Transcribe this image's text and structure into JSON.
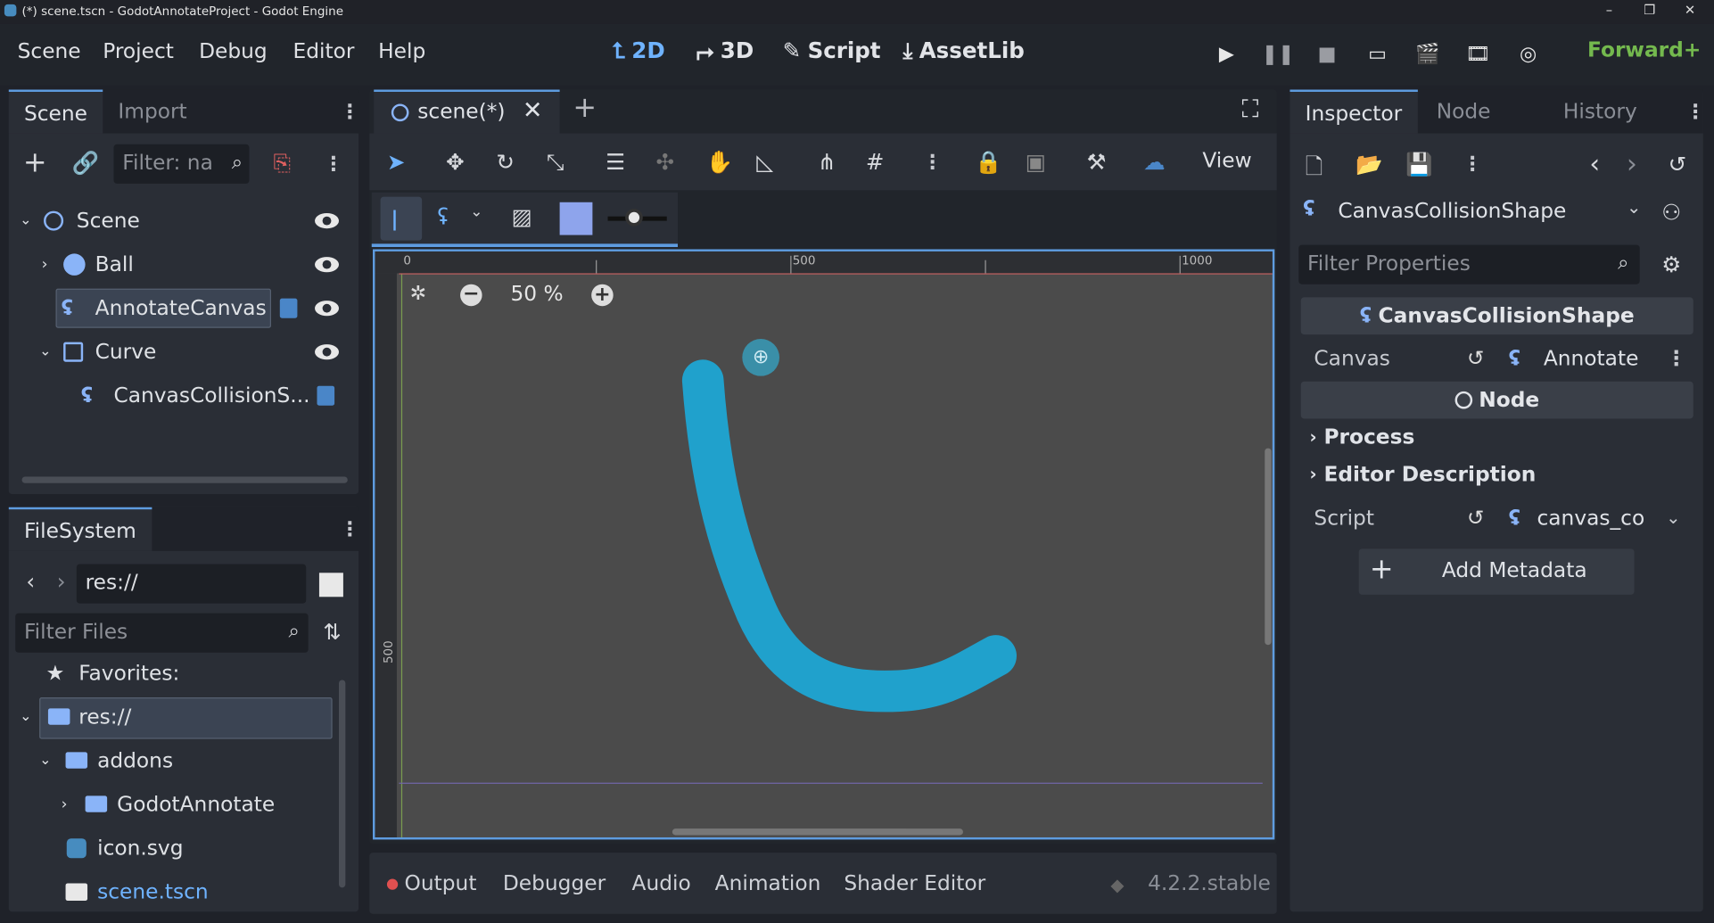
{
  "window": {
    "title": "(*) scene.tscn - GodotAnnotateProject - Godot Engine",
    "controls": [
      "–",
      "❐",
      "✕"
    ]
  },
  "menu": [
    "Scene",
    "Project",
    "Debug",
    "Editor",
    "Help"
  ],
  "workspaces": [
    {
      "label": "2D",
      "icon": "2d-icon",
      "active": true
    },
    {
      "label": "3D",
      "icon": "3d-icon",
      "active": false
    },
    {
      "label": "Script",
      "icon": "script-icon",
      "active": false
    },
    {
      "label": "AssetLib",
      "icon": "assetlib-icon",
      "active": false
    }
  ],
  "renderer": "Forward+",
  "scene_dock": {
    "tabs": [
      "Scene",
      "Import"
    ],
    "filter_placeholder": "Filter: na",
    "tree": [
      {
        "label": "Scene",
        "depth": 0,
        "icon": "node-circle-icon",
        "expanded": true
      },
      {
        "label": "Ball",
        "depth": 1,
        "icon": "rigidbody-icon",
        "expanded": false
      },
      {
        "label": "AnnotateCanvas",
        "depth": 1,
        "icon": "annotate-icon",
        "selected": true
      },
      {
        "label": "Curve",
        "depth": 1,
        "icon": "control-icon",
        "expanded": true
      },
      {
        "label": "CanvasCollisionS...",
        "depth": 2,
        "icon": "annotate-icon"
      }
    ]
  },
  "filesystem_dock": {
    "tab": "FileSystem",
    "path": "res://",
    "filter_placeholder": "Filter Files",
    "items": [
      {
        "label": "Favorites:",
        "icon": "star-icon"
      },
      {
        "label": "res://",
        "icon": "folder-icon",
        "selected": true
      },
      {
        "label": "addons",
        "icon": "folder-icon"
      },
      {
        "label": "GodotAnnotate",
        "icon": "folder-icon"
      },
      {
        "label": "icon.svg",
        "icon": "image-icon"
      },
      {
        "label": "scene.tscn",
        "icon": "clapper-icon"
      }
    ]
  },
  "editor": {
    "tab": "scene(*)",
    "toolbar_view": "View",
    "zoom": "50 %",
    "ruler": {
      "h": [
        "0",
        "500",
        "1000"
      ],
      "v": [
        "500"
      ]
    }
  },
  "bottom_panel": {
    "tabs": [
      "Output",
      "Debugger",
      "Audio",
      "Animation",
      "Shader Editor"
    ],
    "version": "4.2.2.stable"
  },
  "inspector": {
    "tabs": [
      "Inspector",
      "Node",
      "History"
    ],
    "object": "CanvasCollisionShape",
    "filter_placeholder": "Filter Properties",
    "class_header": "CanvasCollisionShape",
    "canvas_label": "Canvas",
    "canvas_value": "Annotate",
    "node_header": "Node",
    "sections": [
      "Process",
      "Editor Description"
    ],
    "script_label": "Script",
    "script_value": "canvas_co",
    "add_metadata": "Add Metadata"
  },
  "colors": {
    "accent": "#5e9ce0",
    "stroke": "#1ea5d3",
    "renderer": "#74b94e"
  }
}
